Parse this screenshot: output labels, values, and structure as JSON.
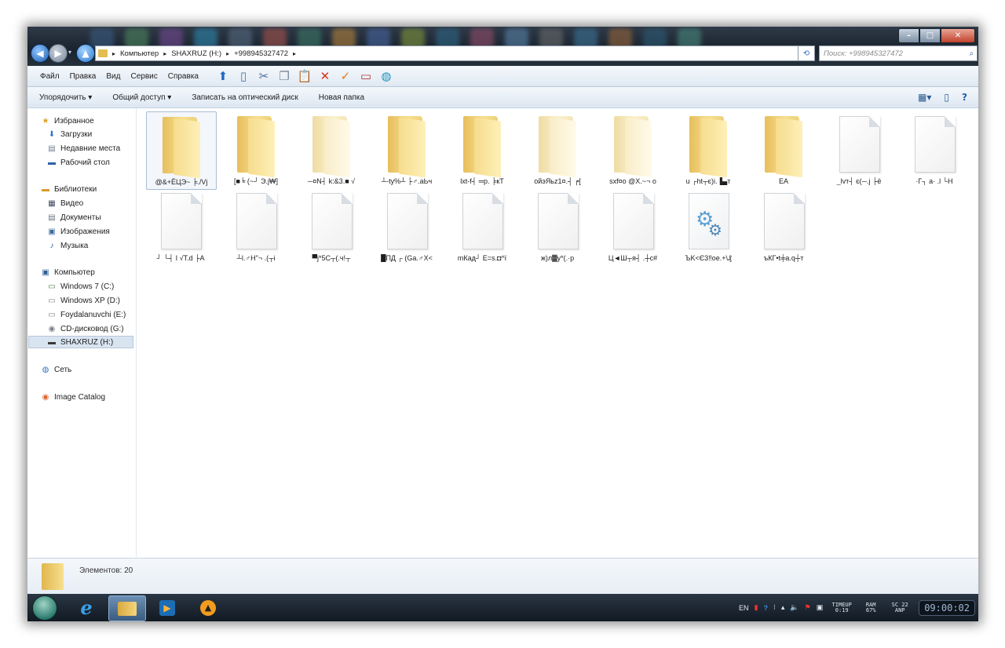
{
  "address": {
    "crumbs": [
      "Компьютер",
      "SHAXRUZ (H:)",
      "+998945327472"
    ]
  },
  "search": {
    "placeholder": "Поиск: +998945327472"
  },
  "menu": [
    "Файл",
    "Правка",
    "Вид",
    "Сервис",
    "Справка"
  ],
  "commands": [
    "Упорядочить ▾",
    "Общий доступ ▾",
    "Записать на оптический диск",
    "Новая папка"
  ],
  "sidebar": {
    "favorites": "Избранное",
    "downloads": "Загрузки",
    "recent": "Недавние места",
    "desktop": "Рабочий стол",
    "libraries": "Библиотеки",
    "video": "Видео",
    "documents": "Документы",
    "images": "Изображения",
    "music": "Музыка",
    "computer": "Компьютер",
    "drive_c": "Windows 7 (C:)",
    "drive_d": "Windows XP (D:)",
    "drive_e": "Foydalanuvchi (E:)",
    "drive_g": "CD-дисковод (G:)",
    "drive_h": "SHAXRUZ (H:)",
    "network": "Сеть",
    "catalog": "Image Catalog"
  },
  "items": [
    {
      "label": "@&+ЁЦЭ~ ╞./Vj",
      "type": "folder"
    },
    {
      "label": "[■╘ (~┘ Э.j₩]",
      "type": "folder"
    },
    {
      "label": "─¤N┤ k:&3.■ √",
      "type": "folder"
    },
    {
      "label": "┴-ty%┴ ├♂.aЬч",
      "type": "folder"
    },
    {
      "label": "lxt-f┤ ═p. ╞кТ",
      "type": "folder"
    },
    {
      "label": "ойэЯьz1¤.┤ ┍[",
      "type": "folder"
    },
    {
      "label": "sxf¤o @X.~¬ o",
      "type": "folder"
    },
    {
      "label": "u ┌ht┬є)i.▐▄т",
      "type": "folder"
    },
    {
      "label": "EA",
      "type": "folder"
    },
    {
      "label": "_lvт┤ є(─.j ├ё",
      "type": "file"
    },
    {
      "label": "·Г┐ a· .l └H",
      "type": "file"
    },
    {
      "label": "┘ └┤ I √T.d ├A",
      "type": "file"
    },
    {
      "label": "┴l.♂H\"¬ .(┬i",
      "type": "file"
    },
    {
      "label": "▀j*5C┬(.ч!┬",
      "type": "file"
    },
    {
      "label": "█ПД ┌ (Ga.♂X<",
      "type": "file"
    },
    {
      "label": "mКад┘ E=s.◘^ï",
      "type": "file"
    },
    {
      "label": "ж)л▓у*(.·p",
      "type": "file"
    },
    {
      "label": "Ц◄Ш┬я┤ .┼c#",
      "type": "file"
    },
    {
      "label": "ЪK<Є3‼oe.+\\₰",
      "type": "app"
    },
    {
      "label": "ъКГ•t╪a.q┼т",
      "type": "file"
    }
  ],
  "status": {
    "count": "Элементов: 20"
  },
  "tray": {
    "lang": "EN",
    "time_label": "TIMEUP 0:19",
    "ram_label": "RAM 67%",
    "sc_label": "SC 22 ANP",
    "clock": "09:00:02"
  }
}
